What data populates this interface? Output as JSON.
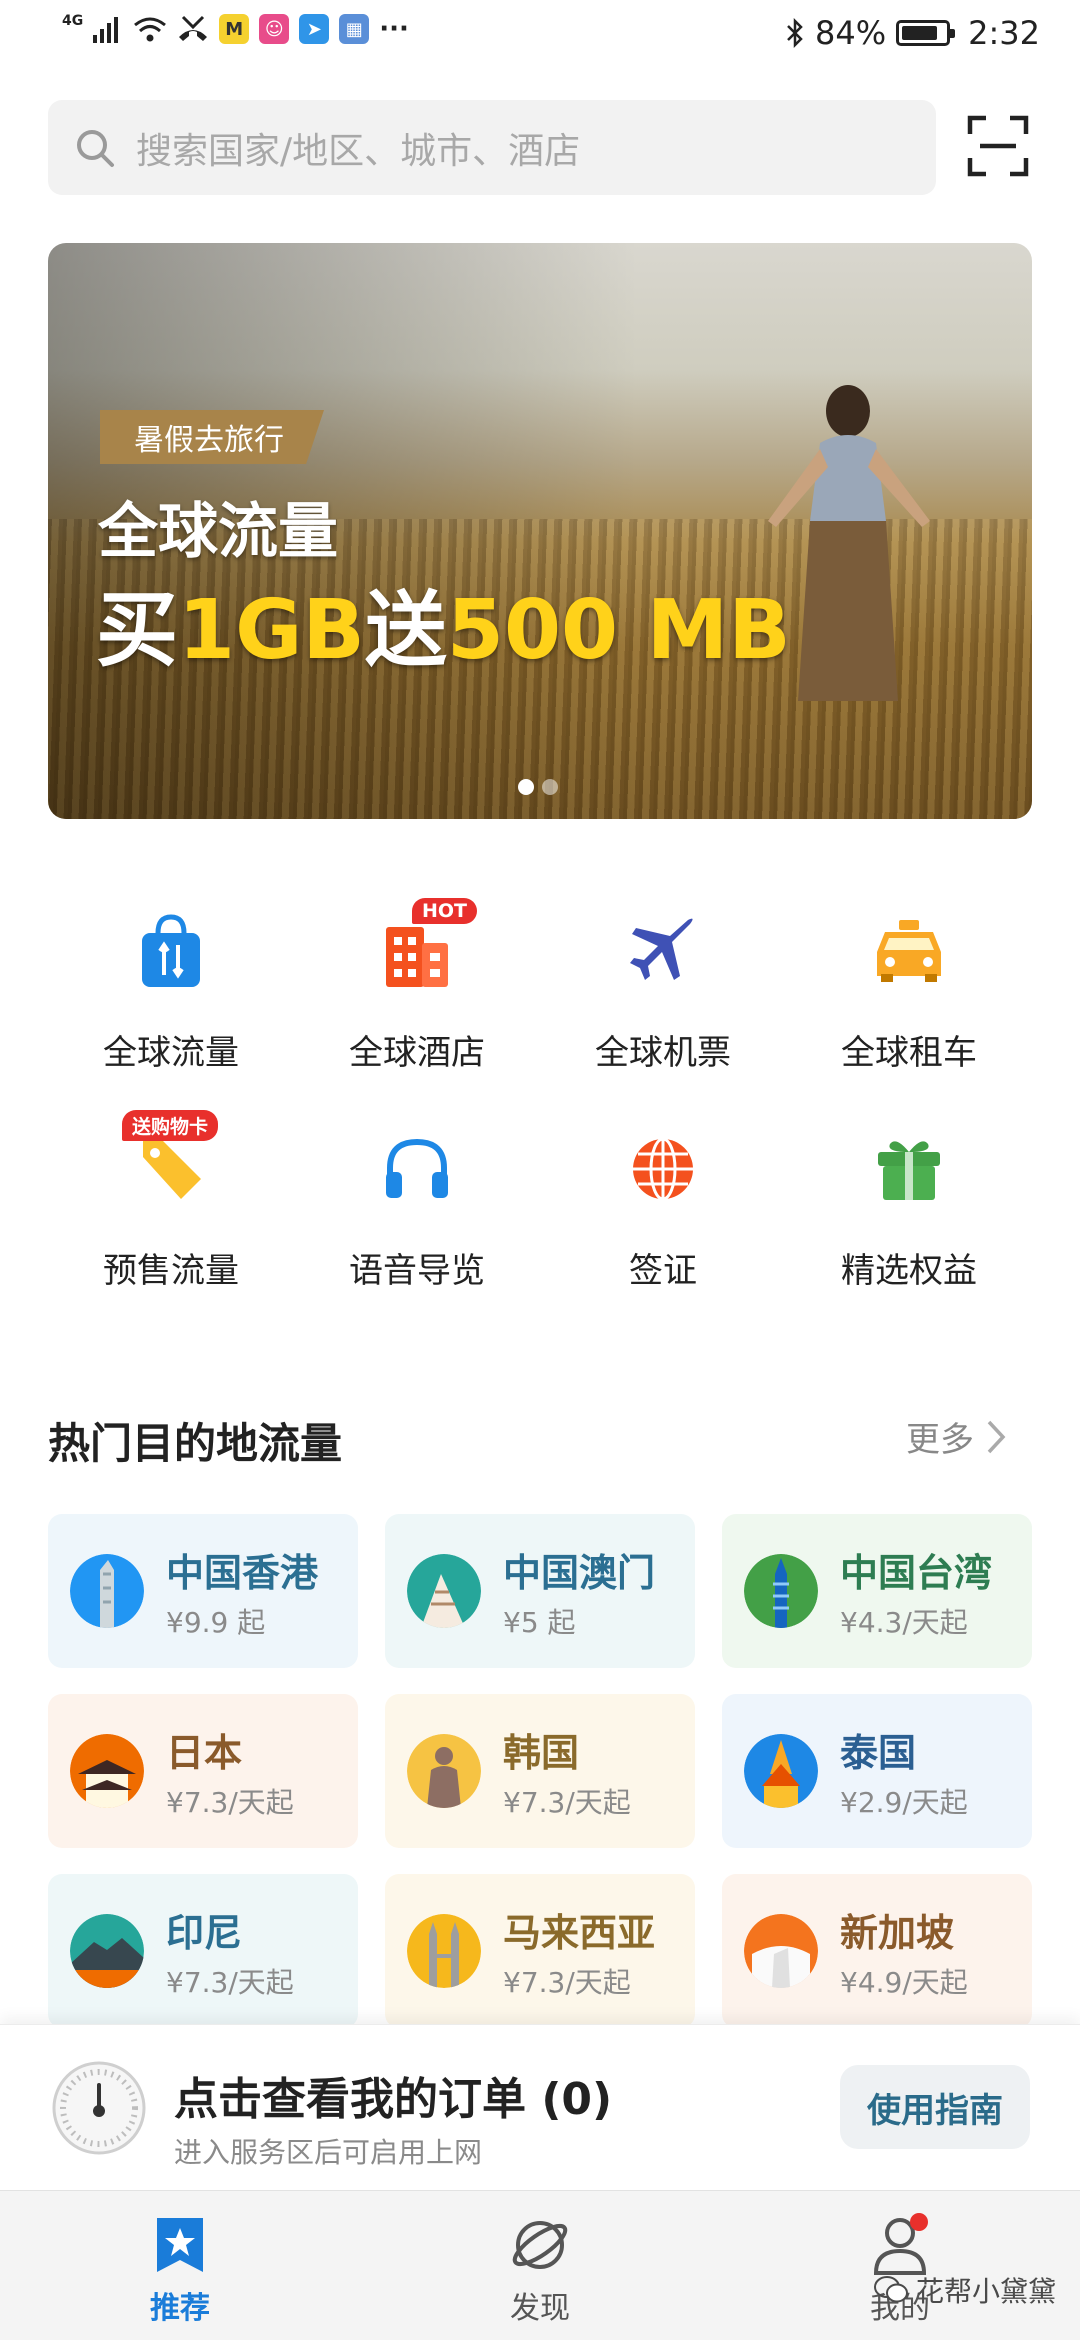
{
  "status_bar": {
    "network": "4G",
    "app_badge_m": "M",
    "more": "···",
    "battery": "84%",
    "battery_level": 0.84,
    "time": "2:32"
  },
  "search": {
    "placeholder": "搜索国家/地区、城市、酒店"
  },
  "banner": {
    "tag": "暑假去旅行",
    "title": "全球流量",
    "promo_prefix": "买",
    "promo_hl1": "1GB",
    "promo_mid": "送",
    "promo_hl2": "500 MB",
    "slides": 2,
    "active_slide": 1
  },
  "quick_menu": [
    {
      "label": "全球流量",
      "icon": "shopping-bag-icon",
      "color": "#1e88e5"
    },
    {
      "label": "全球酒店",
      "icon": "hotel-building-icon",
      "color": "#f4511e",
      "badge": "HOT"
    },
    {
      "label": "全球机票",
      "icon": "airplane-icon",
      "color": "#3f51b5"
    },
    {
      "label": "全球租车",
      "icon": "taxi-icon",
      "color": "#f9a825"
    },
    {
      "label": "预售流量",
      "icon": "price-tag-icon",
      "color": "#fbc02d",
      "badge": "送购物卡"
    },
    {
      "label": "语音导览",
      "icon": "headphones-icon",
      "color": "#1e88e5"
    },
    {
      "label": "签证",
      "icon": "globe-icon",
      "color": "#f4511e"
    },
    {
      "label": "精选权益",
      "icon": "gift-icon",
      "color": "#43a047"
    }
  ],
  "section": {
    "title": "热门目的地流量",
    "more": "更多"
  },
  "destinations": [
    {
      "name": "中国香港",
      "price": "¥9.9 起",
      "bg": "#eef6fb",
      "color": "#2b6f92",
      "thumb": "#2196f3"
    },
    {
      "name": "中国澳门",
      "price": "¥5 起",
      "bg": "#eef7f8",
      "color": "#2b6f92",
      "thumb": "#26a69a"
    },
    {
      "name": "中国台湾",
      "price": "¥4.3/天起",
      "bg": "#eff8ef",
      "color": "#2e7d52",
      "thumb": "#43a047"
    },
    {
      "name": "日本",
      "price": "¥7.3/天起",
      "bg": "#fdf3ec",
      "color": "#8a5a2b",
      "thumb": "#ef6c00"
    },
    {
      "name": "韩国",
      "price": "¥7.3/天起",
      "bg": "#fdf7ea",
      "color": "#8a6a2b",
      "thumb": "#f6c343"
    },
    {
      "name": "泰国",
      "price": "¥2.9/天起",
      "bg": "#eef5fc",
      "color": "#2b5f92",
      "thumb": "#1e88e5"
    },
    {
      "name": "印尼",
      "price": "¥7.3/天起",
      "bg": "#eef7f8",
      "color": "#2b6f92",
      "thumb": "#26a69a"
    },
    {
      "name": "马来西亚",
      "price": "¥7.3/天起",
      "bg": "#fdf7ea",
      "color": "#8a6a2b",
      "thumb": "#f6b81c"
    },
    {
      "name": "新加坡",
      "price": "¥4.9/天起",
      "bg": "#fdf3ec",
      "color": "#8a5a2b",
      "thumb": "#f4741e"
    }
  ],
  "order": {
    "title": "点击查看我的订单 (0)",
    "subtitle": "进入服务区后可启用上网",
    "guide": "使用指南"
  },
  "tabs": [
    {
      "label": "推荐",
      "active": true
    },
    {
      "label": "发现",
      "active": false
    },
    {
      "label": "我的",
      "active": false
    }
  ],
  "watermark": "花帮小黛黛",
  "colors": {
    "accent": "#1a7cd9",
    "promo_yellow": "#ffd21a",
    "badge_red": "#e8302c"
  }
}
